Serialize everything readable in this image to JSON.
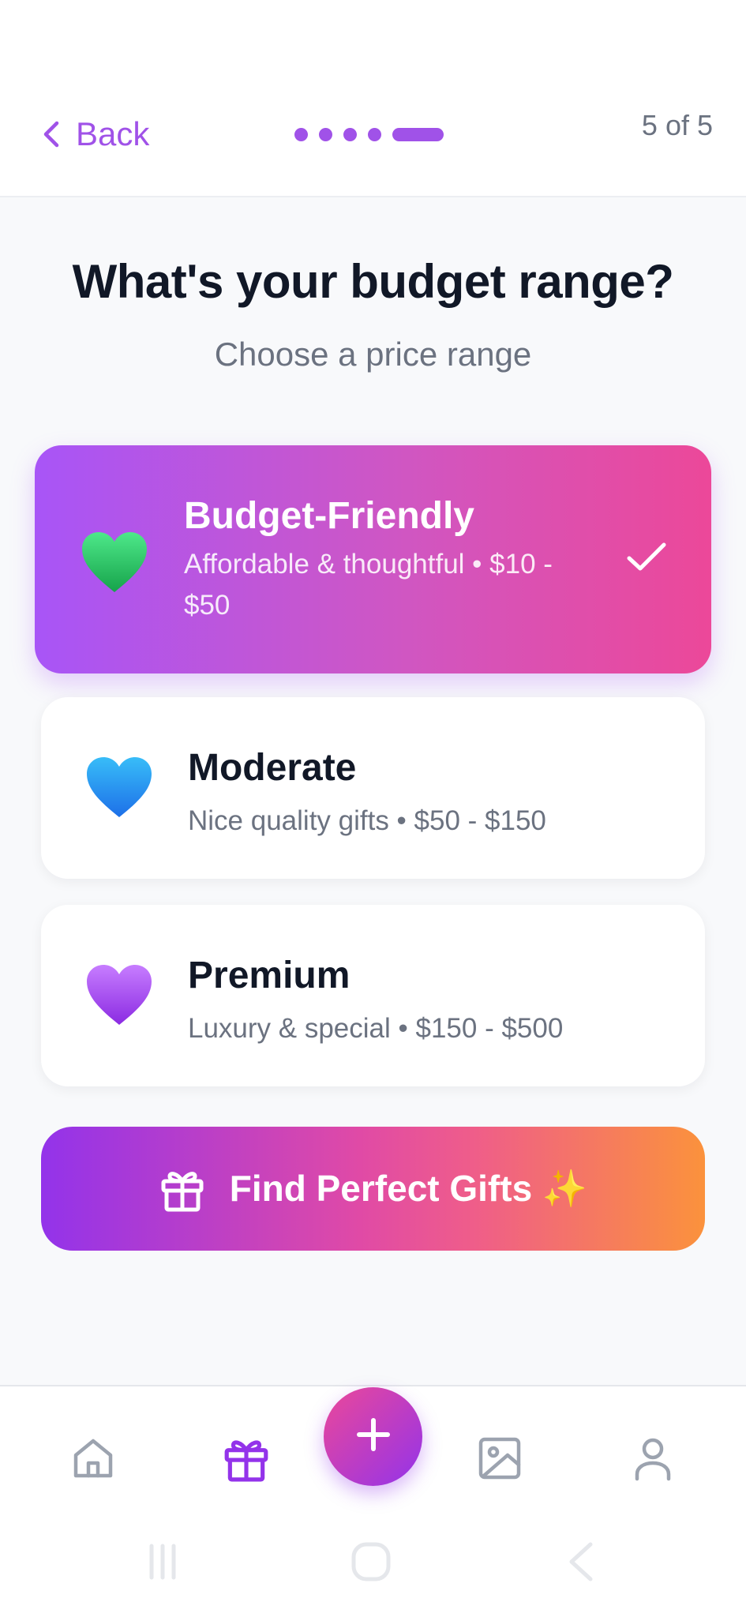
{
  "header": {
    "back_label": "Back",
    "step_text": "5 of 5",
    "progress": {
      "current_step": 5,
      "total_steps": 5
    }
  },
  "title": "What's your budget range?",
  "subtitle": "Choose a price range",
  "options": [
    {
      "title": "Budget-Friendly",
      "description": "Affordable & thoughtful • $10 - $50",
      "icon": "green-heart-icon",
      "selected": true
    },
    {
      "title": "Moderate",
      "description": "Nice quality gifts • $50 - $150",
      "icon": "blue-heart-icon",
      "selected": false
    },
    {
      "title": "Premium",
      "description": "Luxury & special • $150 - $500",
      "icon": "purple-heart-icon",
      "selected": false
    }
  ],
  "cta": {
    "label": "Find Perfect Gifts ✨",
    "icon": "gift-icon"
  },
  "bottom_nav": {
    "items": [
      {
        "icon": "home-icon",
        "active": false
      },
      {
        "icon": "gift-icon",
        "active": true
      },
      {
        "icon": "plus-icon",
        "active": false
      },
      {
        "icon": "image-icon",
        "active": false
      },
      {
        "icon": "user-icon",
        "active": false
      }
    ]
  },
  "colors": {
    "accent": "#a052e8",
    "selected_gradient_start": "#a855f7",
    "selected_gradient_end": "#ec4899",
    "cta_gradient_start": "#9333ea",
    "cta_gradient_end": "#fb923c",
    "text_primary": "#111827",
    "text_secondary": "#6b7280",
    "background": "#f8f9fb"
  }
}
